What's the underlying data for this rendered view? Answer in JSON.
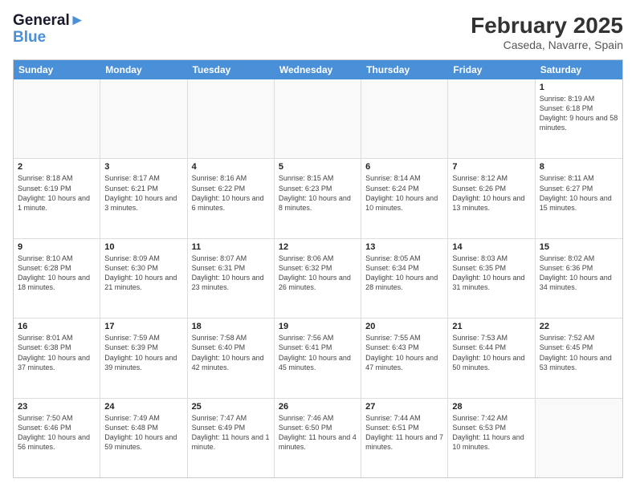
{
  "header": {
    "logo_line1": "General",
    "logo_line2": "Blue",
    "month_year": "February 2025",
    "location": "Caseda, Navarre, Spain"
  },
  "days_of_week": [
    "Sunday",
    "Monday",
    "Tuesday",
    "Wednesday",
    "Thursday",
    "Friday",
    "Saturday"
  ],
  "rows": [
    [
      {
        "day": "",
        "text": ""
      },
      {
        "day": "",
        "text": ""
      },
      {
        "day": "",
        "text": ""
      },
      {
        "day": "",
        "text": ""
      },
      {
        "day": "",
        "text": ""
      },
      {
        "day": "",
        "text": ""
      },
      {
        "day": "1",
        "text": "Sunrise: 8:19 AM\nSunset: 6:18 PM\nDaylight: 9 hours and 58 minutes."
      }
    ],
    [
      {
        "day": "2",
        "text": "Sunrise: 8:18 AM\nSunset: 6:19 PM\nDaylight: 10 hours and 1 minute."
      },
      {
        "day": "3",
        "text": "Sunrise: 8:17 AM\nSunset: 6:21 PM\nDaylight: 10 hours and 3 minutes."
      },
      {
        "day": "4",
        "text": "Sunrise: 8:16 AM\nSunset: 6:22 PM\nDaylight: 10 hours and 6 minutes."
      },
      {
        "day": "5",
        "text": "Sunrise: 8:15 AM\nSunset: 6:23 PM\nDaylight: 10 hours and 8 minutes."
      },
      {
        "day": "6",
        "text": "Sunrise: 8:14 AM\nSunset: 6:24 PM\nDaylight: 10 hours and 10 minutes."
      },
      {
        "day": "7",
        "text": "Sunrise: 8:12 AM\nSunset: 6:26 PM\nDaylight: 10 hours and 13 minutes."
      },
      {
        "day": "8",
        "text": "Sunrise: 8:11 AM\nSunset: 6:27 PM\nDaylight: 10 hours and 15 minutes."
      }
    ],
    [
      {
        "day": "9",
        "text": "Sunrise: 8:10 AM\nSunset: 6:28 PM\nDaylight: 10 hours and 18 minutes."
      },
      {
        "day": "10",
        "text": "Sunrise: 8:09 AM\nSunset: 6:30 PM\nDaylight: 10 hours and 21 minutes."
      },
      {
        "day": "11",
        "text": "Sunrise: 8:07 AM\nSunset: 6:31 PM\nDaylight: 10 hours and 23 minutes."
      },
      {
        "day": "12",
        "text": "Sunrise: 8:06 AM\nSunset: 6:32 PM\nDaylight: 10 hours and 26 minutes."
      },
      {
        "day": "13",
        "text": "Sunrise: 8:05 AM\nSunset: 6:34 PM\nDaylight: 10 hours and 28 minutes."
      },
      {
        "day": "14",
        "text": "Sunrise: 8:03 AM\nSunset: 6:35 PM\nDaylight: 10 hours and 31 minutes."
      },
      {
        "day": "15",
        "text": "Sunrise: 8:02 AM\nSunset: 6:36 PM\nDaylight: 10 hours and 34 minutes."
      }
    ],
    [
      {
        "day": "16",
        "text": "Sunrise: 8:01 AM\nSunset: 6:38 PM\nDaylight: 10 hours and 37 minutes."
      },
      {
        "day": "17",
        "text": "Sunrise: 7:59 AM\nSunset: 6:39 PM\nDaylight: 10 hours and 39 minutes."
      },
      {
        "day": "18",
        "text": "Sunrise: 7:58 AM\nSunset: 6:40 PM\nDaylight: 10 hours and 42 minutes."
      },
      {
        "day": "19",
        "text": "Sunrise: 7:56 AM\nSunset: 6:41 PM\nDaylight: 10 hours and 45 minutes."
      },
      {
        "day": "20",
        "text": "Sunrise: 7:55 AM\nSunset: 6:43 PM\nDaylight: 10 hours and 47 minutes."
      },
      {
        "day": "21",
        "text": "Sunrise: 7:53 AM\nSunset: 6:44 PM\nDaylight: 10 hours and 50 minutes."
      },
      {
        "day": "22",
        "text": "Sunrise: 7:52 AM\nSunset: 6:45 PM\nDaylight: 10 hours and 53 minutes."
      }
    ],
    [
      {
        "day": "23",
        "text": "Sunrise: 7:50 AM\nSunset: 6:46 PM\nDaylight: 10 hours and 56 minutes."
      },
      {
        "day": "24",
        "text": "Sunrise: 7:49 AM\nSunset: 6:48 PM\nDaylight: 10 hours and 59 minutes."
      },
      {
        "day": "25",
        "text": "Sunrise: 7:47 AM\nSunset: 6:49 PM\nDaylight: 11 hours and 1 minute."
      },
      {
        "day": "26",
        "text": "Sunrise: 7:46 AM\nSunset: 6:50 PM\nDaylight: 11 hours and 4 minutes."
      },
      {
        "day": "27",
        "text": "Sunrise: 7:44 AM\nSunset: 6:51 PM\nDaylight: 11 hours and 7 minutes."
      },
      {
        "day": "28",
        "text": "Sunrise: 7:42 AM\nSunset: 6:53 PM\nDaylight: 11 hours and 10 minutes."
      },
      {
        "day": "",
        "text": ""
      }
    ]
  ]
}
